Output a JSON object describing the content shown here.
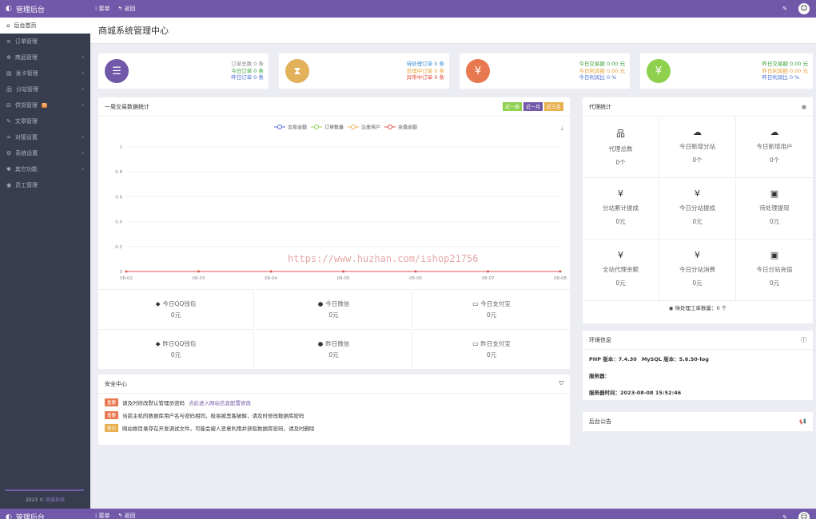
{
  "topbar": {
    "title": "管理后台",
    "menu": "菜单",
    "back": "返回",
    "tool_icon": "wrench-icon",
    "avatar": "☺"
  },
  "sidebar": {
    "items": [
      {
        "label": "后台首页",
        "icon": "home-icon",
        "arrow": false
      },
      {
        "label": "订单管理",
        "icon": "list-icon",
        "arrow": false
      },
      {
        "label": "商品管理",
        "icon": "cart-icon",
        "arrow": true
      },
      {
        "label": "发卡管理",
        "icon": "card-icon",
        "arrow": true
      },
      {
        "label": "分站管理",
        "icon": "sitemap-icon",
        "arrow": true
      },
      {
        "label": "供货管理",
        "icon": "supply-icon",
        "arrow": true,
        "badge": "5"
      },
      {
        "label": "文章管理",
        "icon": "article-icon",
        "arrow": false
      },
      {
        "label": "对接设置",
        "icon": "link-icon",
        "arrow": true
      },
      {
        "label": "系统设置",
        "icon": "gear-icon",
        "arrow": true
      },
      {
        "label": "其它功能",
        "icon": "tools-icon",
        "arrow": true
      },
      {
        "label": "员工管理",
        "icon": "user-icon",
        "arrow": false
      }
    ],
    "footer_year": "2023 ©",
    "footer_link": "商城系统"
  },
  "page_title": "商城系统管理中心",
  "stats": [
    {
      "icon": "☰",
      "color": "#7158a8",
      "lines": [
        {
          "t": "订单总数 0 条",
          "c": "#888"
        },
        {
          "t": "今日订单 0 条",
          "c": "#3a9e3a"
        },
        {
          "t": "昨日订单 0 条",
          "c": "#4b6fd4"
        }
      ]
    },
    {
      "icon": "⧗",
      "color": "#e2b15a",
      "lines": [
        {
          "t": "待处理订单 0 条",
          "c": "#3a8fd1"
        },
        {
          "t": "处理中订单 0 条",
          "c": "#e8a23a"
        },
        {
          "t": "异常中订单 0 条",
          "c": "#e04a3a"
        }
      ]
    },
    {
      "icon": "¥",
      "color": "#e8784f",
      "lines": [
        {
          "t": "今日交易额 0.00 元",
          "c": "#3a9e3a"
        },
        {
          "t": "今日利润额 0.00 元",
          "c": "#e8a23a"
        },
        {
          "t": "今日利润比 0 %",
          "c": "#4b6fd4"
        }
      ]
    },
    {
      "icon": "¥",
      "color": "#8fd14f",
      "lines": [
        {
          "t": "昨日交易额 0.00 元",
          "c": "#3a9e3a"
        },
        {
          "t": "昨日利润额 0.00 元",
          "c": "#e8a23a"
        },
        {
          "t": "昨日利润比 0 %",
          "c": "#4b6fd4"
        }
      ]
    }
  ],
  "chart_panel": {
    "title": "一周交易数据统计",
    "buttons": [
      {
        "label": "近一周",
        "color": "#8fd14f"
      },
      {
        "label": "近一月",
        "color": "#7158a8"
      },
      {
        "label": "近三月",
        "color": "#e8b050"
      }
    ]
  },
  "chart_data": {
    "type": "line",
    "x": [
      "08-02",
      "08-03",
      "08-04",
      "08-05",
      "08-06",
      "08-07",
      "08-08"
    ],
    "series": [
      {
        "name": "交易金额",
        "color": "#4b6fd4",
        "values": [
          0,
          0,
          0,
          0,
          0,
          0,
          0
        ]
      },
      {
        "name": "订单数量",
        "color": "#8fd14f",
        "values": [
          0,
          0,
          0,
          0,
          0,
          0,
          0
        ]
      },
      {
        "name": "注册用户",
        "color": "#e8b050",
        "values": [
          0,
          0,
          0,
          0,
          0,
          0,
          0
        ]
      },
      {
        "name": "充值金额",
        "color": "#e05050",
        "values": [
          0,
          0,
          0,
          0,
          0,
          0,
          0
        ]
      }
    ],
    "yticks": [
      "0",
      "0.2",
      "0.4",
      "0.6",
      "0.8",
      "1"
    ],
    "ylim": [
      0,
      1
    ],
    "legend": "top-center"
  },
  "pay": [
    {
      "icon": "qq-icon",
      "glyph": "◆",
      "label": "今日QQ钱包",
      "value": "0元"
    },
    {
      "icon": "wechat-icon",
      "glyph": "●",
      "label": "今日微信",
      "value": "0元"
    },
    {
      "icon": "alipay-icon",
      "glyph": "▭",
      "label": "今日支付宝",
      "value": "0元"
    },
    {
      "icon": "qq-icon",
      "glyph": "◆",
      "label": "昨日QQ钱包",
      "value": "0元"
    },
    {
      "icon": "wechat-icon",
      "glyph": "●",
      "label": "昨日微信",
      "value": "0元"
    },
    {
      "icon": "alipay-icon",
      "glyph": "▭",
      "label": "昨日支付宝",
      "value": "0元"
    }
  ],
  "security": {
    "title": "安全中心",
    "notices": [
      {
        "tag": "重要",
        "color": "#e8784f",
        "text": "请及时修改默认管理员密码",
        "link": "点此进入网站信息配置修改"
      },
      {
        "tag": "重要",
        "color": "#e8784f",
        "text": "当前主机的数据库用户名与密码相同，极易被黑客破解，请及时修改数据库密码",
        "link": ""
      },
      {
        "tag": "提示",
        "color": "#e8b050",
        "text": "网站根目录存在开发调试文件，可能会被人恶意利用并获取数据库密码，请及时删除",
        "link": ""
      }
    ]
  },
  "agent": {
    "title": "代理统计",
    "cells": [
      {
        "icon": "sitemap-icon",
        "glyph": "品",
        "label": "代理总数",
        "value": "0个"
      },
      {
        "icon": "cloud-icon",
        "glyph": "☁",
        "label": "今日新增分站",
        "value": "0个"
      },
      {
        "icon": "cloud-icon",
        "glyph": "☁",
        "label": "今日新增用户",
        "value": "0个"
      },
      {
        "icon": "yen-icon",
        "glyph": "¥",
        "label": "分站累计提成",
        "value": "0元"
      },
      {
        "icon": "yen-icon",
        "glyph": "¥",
        "label": "今日分站提成",
        "value": "0元"
      },
      {
        "icon": "money-icon",
        "glyph": "▣",
        "label": "待处理提现",
        "value": "0元"
      },
      {
        "icon": "yen-icon",
        "glyph": "¥",
        "label": "全站代理余额",
        "value": "0元"
      },
      {
        "icon": "yen-icon",
        "glyph": "¥",
        "label": "今日分站消费",
        "value": "0元"
      },
      {
        "icon": "money-icon",
        "glyph": "▣",
        "label": "今日分站充值",
        "value": "0元"
      }
    ],
    "ticket": "待处理工单数量：0 个"
  },
  "sysinfo": {
    "title": "环境信息",
    "php": "PHP 版本：7.4.30",
    "mysql": "MySQL 版本：5.6.50-log",
    "server": "服务器：",
    "time": "服务器时间：2023-08-08 15:52:46"
  },
  "announce": {
    "title": "后台公告"
  },
  "watermark": "https://www.huzhan.com/ishop21756"
}
